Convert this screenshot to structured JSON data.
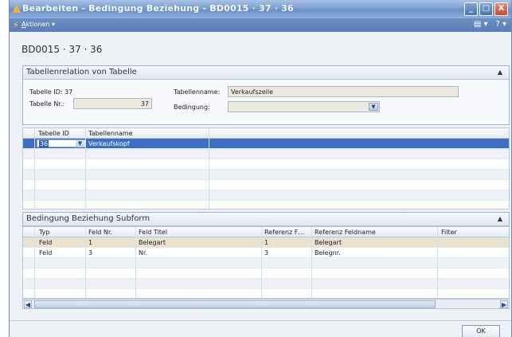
{
  "window": {
    "title": "Bearbeiten - Bedingung Beziehung - BD0015 · 37 · 36",
    "buttons": {
      "minimize": "_",
      "maximize": "□",
      "close": "X"
    }
  },
  "menubar": {
    "actions_accel": "A",
    "actions_rest": "ktionen",
    "actions_arrow": "▾",
    "view_glyph": "▤ ▾",
    "help_glyph": "? ▾"
  },
  "record_title": "BD0015 · 37 · 36",
  "section1": {
    "title": "Tabellenrelation von Tabelle",
    "tabelle_id_label": "Tabelle ID:",
    "tabelle_id_value": "37",
    "tabelle_nr_label": "Tabelle Nr.:",
    "tabelle_nr_value": "37",
    "tabellenname_label": "Tabellenname:",
    "tabellenname_value": "Verkaufszeile",
    "bedingung_label": "Bedingung:",
    "bedingung_value": ""
  },
  "grid1": {
    "headers": [
      "Tabelle ID",
      "Tabellenname"
    ],
    "rows": [
      {
        "id": "36",
        "name": "Verkaufskopf"
      }
    ]
  },
  "section2": {
    "title": "Bedingung Beziehung Subform",
    "headers": [
      "Typ",
      "Feld Nr.",
      "Feld Titel",
      "Referenz F…",
      "Referenz Feldname",
      "Filter"
    ],
    "rows": [
      {
        "typ": "Feld",
        "feld_nr": "1",
        "feld_titel": "Belegart",
        "ref_f": "1",
        "ref_name": "Belegart",
        "filter": ""
      },
      {
        "typ": "Feld",
        "feld_nr": "3",
        "feld_titel": "Nr.",
        "ref_f": "3",
        "ref_name": "Belegnr.",
        "filter": ""
      }
    ]
  },
  "colors": {
    "selected_row": "#3d6fc4",
    "highlight_row": "#e8e3cf",
    "titlebar": "#7b9fd0"
  },
  "ok_label": "OK"
}
